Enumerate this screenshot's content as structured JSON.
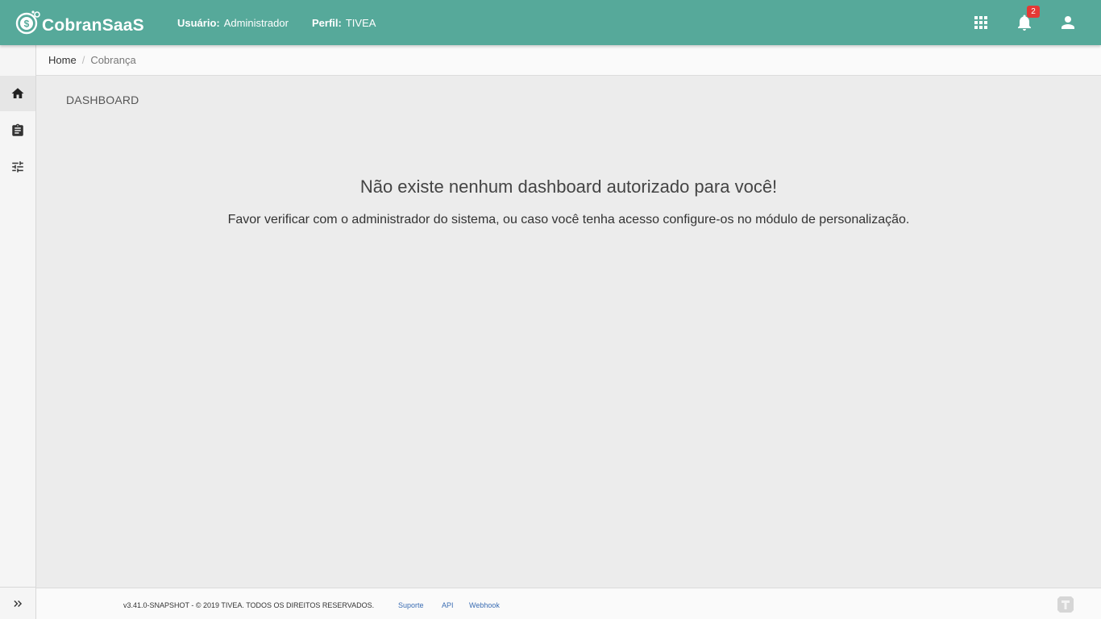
{
  "app": {
    "brand": "CobranSaaS",
    "user_label": "Usuário:",
    "user_value": "Administrador",
    "profile_label": "Perfil:",
    "profile_value": "TIVEA",
    "notification_count": "2"
  },
  "breadcrumb": {
    "home": "Home",
    "separator": "/",
    "current": "Cobrança"
  },
  "sidebar": {
    "items": [
      {
        "name": "home-icon",
        "active": true
      },
      {
        "name": "clipboard-icon",
        "active": false
      },
      {
        "name": "tune-icon",
        "active": false
      }
    ],
    "toggle_icon": "chevron-double-right-icon"
  },
  "main": {
    "title": "DASHBOARD",
    "empty_title": "Não existe nenhum dashboard autorizado para você!",
    "empty_message": "Favor verificar com o administrador do sistema, ou caso você tenha acesso configure-os no módulo de personalização."
  },
  "footer": {
    "copyright": "v3.41.0-SNAPSHOT - © 2019 TIVEA. TODOS OS DIREITOS RESERVADOS.",
    "links": [
      "Suporte",
      "API",
      "Webhook"
    ]
  },
  "colors": {
    "topbar": "#56a99a",
    "badge": "#e53935",
    "link": "#3b6db3"
  }
}
